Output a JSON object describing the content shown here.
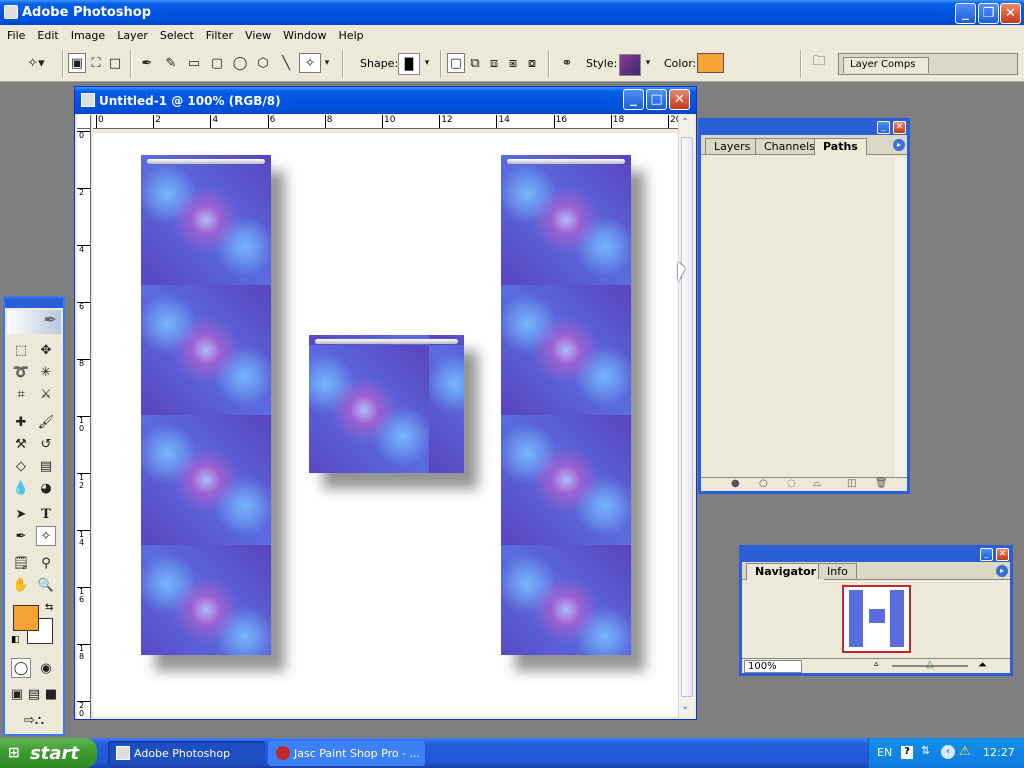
{
  "app": {
    "title": "Adobe Photoshop"
  },
  "menu": [
    "File",
    "Edit",
    "Image",
    "Layer",
    "Select",
    "Filter",
    "View",
    "Window",
    "Help"
  ],
  "options": {
    "shape_label": "Shape:",
    "style_label": "Style:",
    "color_label": "Color:",
    "color_value": "#f7a234",
    "layer_comps_label": "Layer Comps"
  },
  "document": {
    "title": "Untitled-1 @ 100% (RGB/8)",
    "h_ruler_ticks": [
      "0",
      "2",
      "4",
      "6",
      "8",
      "10",
      "12",
      "14",
      "16",
      "18",
      "20"
    ],
    "v_ruler_ticks": [
      "0",
      "2",
      "4",
      "6",
      "8",
      "1\n0",
      "1\n2",
      "1\n4",
      "1\n6",
      "1\n8",
      "2\n0"
    ]
  },
  "layers_panel": {
    "tabs": [
      "Layers",
      "Channels",
      "Paths"
    ],
    "active_tab": "Paths"
  },
  "navigator_panel": {
    "tabs": [
      "Navigator",
      "Info"
    ],
    "active_tab": "Navigator",
    "zoom": "100%"
  },
  "toolbox": {
    "foreground_color": "#f7a234",
    "background_color": "#ffffff"
  },
  "taskbar": {
    "start_label": "start",
    "items": [
      "Adobe Photoshop",
      "Jasc Paint Shop Pro - ..."
    ],
    "language": "EN",
    "clock": "12:27"
  }
}
